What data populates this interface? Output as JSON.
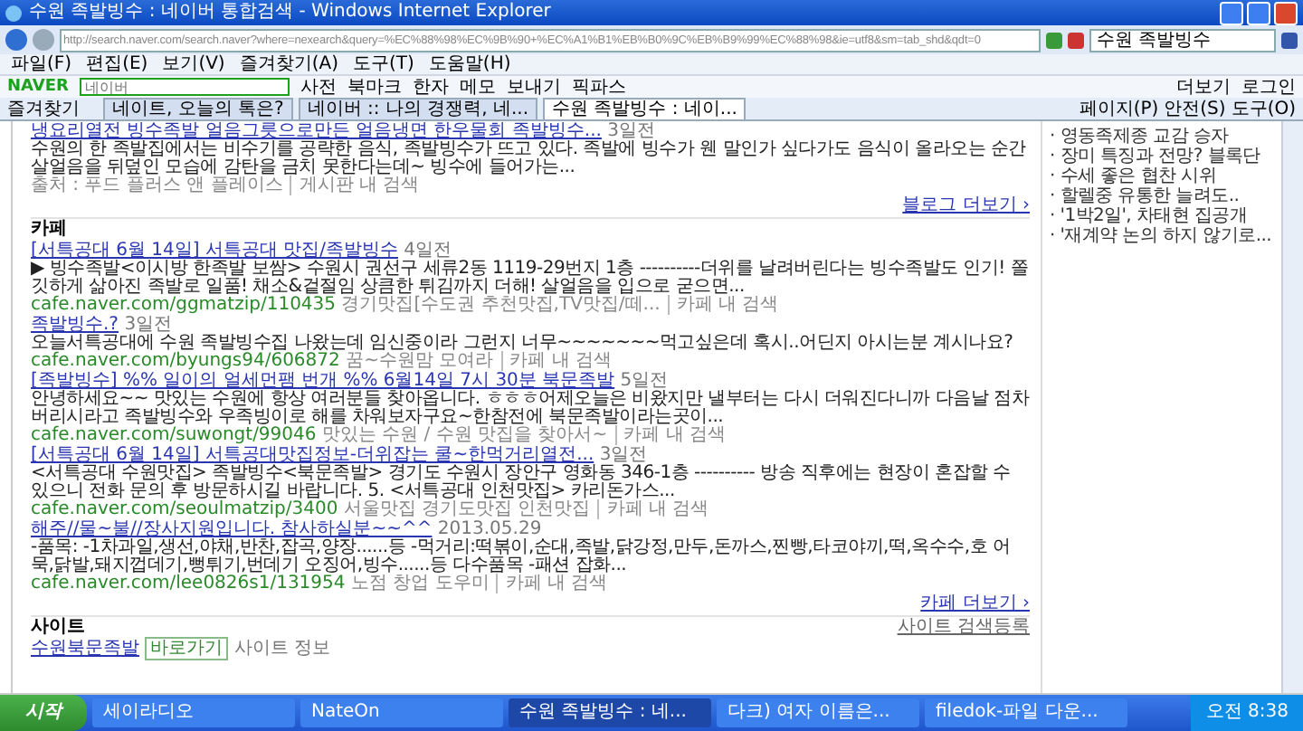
{
  "window": {
    "title": "수원 족발빙수 : 네이버 통합검색 - Windows Internet Explorer"
  },
  "address_bar": {
    "url": "http://search.naver.com/search.naver?where=nexearch&query=%EC%88%98%EC%9B%90+%EC%A1%B1%EB%B0%9C%EB%B9%99%EC%88%98&ie=utf8&sm=tab_shd&qdt=0"
  },
  "search_box": {
    "value": "수원 족발빙수"
  },
  "menu": [
    "파일(F)",
    "편집(E)",
    "보기(V)",
    "즐겨찾기(A)",
    "도구(T)",
    "도움말(H)"
  ],
  "toolbar": {
    "logo": "NAVER",
    "placeholder": "네이버",
    "buttons": [
      "사전",
      "북마크",
      "한자",
      "메모",
      "보내기",
      "픽파스"
    ],
    "right_buttons": [
      "더보기",
      "로그인"
    ]
  },
  "favorites": {
    "label": "즐겨찾기"
  },
  "tabs": [
    {
      "label": "네이트, 오늘의 톡은?",
      "selected": false
    },
    {
      "label": "네이버 :: 나의 경쟁력, 네...",
      "selected": false
    },
    {
      "label": "수원 족발빙수 : 네이...",
      "selected": true
    }
  ],
  "command_bar": [
    "페이지(P)",
    "안전(S)",
    "도구(O)"
  ],
  "blog": {
    "title": "냉요리열전 빙수족발 얼음그릇으로만든 얼음냉면 한우물회 족발빙수...",
    "age": "3일전",
    "description": "수원의 한 족발집에서는 비수기를 공략한 음식, 족발빙수가 뜨고 있다. 족발에 빙수가 웬 말인가 싶다가도 음식이 올라오는 순간 살얼음을 뒤덮인 모습에 감탄을 금치 못한다는데~ 빙수에 들어가는...",
    "source": "출처 : 푸드 플러스 앤 플레이스",
    "filter": "게시판 내 검색",
    "more": "블로그 더보기 ›"
  },
  "cafe": {
    "heading": "카페",
    "more": "카페 더보기 ›",
    "items": [
      {
        "title": "[서특공대 6월 14일] 서특공대 맛집/족발빙수",
        "age": "4일전",
        "description": "▶ 빙수족발<이시방 한족발 보쌈> 수원시 권선구 세류2동 1119-29번지 1층 ----------더위를 날려버린다는 빙수족발도 인기! 쫄깃하게 삶아진 족발로 일품! 채소&겉절임 상큼한 튀김까지 더해! 살얼음을 입으로 굳으면...",
        "url": "cafe.naver.com/ggmatzip/110435",
        "board": "경기맛집[수도권 추천맛집,TV맛집/떼...",
        "filter": "카페 내 검색"
      },
      {
        "title": "족발빙수.?",
        "age": "3일전",
        "description": "오늘서특공대에 수원 족발빙수집 나왔는데 임신중이라 그런지 너무~~~~~~~먹고싶은데 혹시..어딘지 아시는분 계시나요?",
        "url": "cafe.naver.com/byungs94/606872",
        "board": "꿈~수원맘 모여라",
        "filter": "카페 내 검색"
      },
      {
        "title": "[족발빙수] %% 일이의 얼세먼팸 번개 %% 6월14일 7시 30분 북문족발",
        "age": "5일전",
        "description": "안녕하세요~~ 맛있는 수원에 항상 여러분들 찾아옵니다. ㅎㅎㅎ어제오늘은 비왔지만 낼부터는 다시 더워진다니까 다음날 점차 버리시라고 족발빙수와 우족빙이로 해를 차워보자구요~한참전에 북문족발이라는곳이...",
        "url": "cafe.naver.com/suwongt/99046",
        "board": "맛있는 수원 / 수원 맛집을 찾아서~",
        "filter": "카페 내 검색"
      },
      {
        "title": "[서특공대 6월 14일] 서특공대맛집정보-더위잡는 쿨~한먹거리열전...",
        "age": "3일전",
        "description": "<서특공대 수원맛집> 족발빙수<북문족발> 경기도 수원시 장안구 영화동 346-1층 ---------- 방송 직후에는 현장이 혼잡할 수 있으니 전화 문의 후 방문하시길 바랍니다. 5. <서특공대 인천맛집> 카리돈가스...",
        "url": "cafe.naver.com/seoulmatzip/3400",
        "board": "서울맛집 경기도맛집 인천맛집",
        "filter": "카페 내 검색"
      },
      {
        "title": "해주//물~불//장사지원입니다. 참사하실분~~^^",
        "age": "2013.05.29",
        "description": "-품목: -1차과일,생선,야채,반찬,잡곡,양장......등 -먹거리:떡볶이,순대,족발,닭강정,만두,돈까스,찐빵,타코야끼,떡,옥수수,호 어묵,닭발,돼지껍데기,뻥튀기,번데기 오징어,빙수......등 다수품목 -패션 잡화...",
        "url": "cafe.naver.com/lee0826s1/131954",
        "board": "노점 창업 도우미",
        "filter": "카페 내 검색"
      }
    ]
  },
  "site": {
    "heading": "사이트",
    "register": "사이트 검색등록",
    "item": {
      "title": "수원북문족발",
      "tag": "바로가기",
      "note": "사이트 정보"
    }
  },
  "news": [
    "· 영동족제종 교감 승자",
    "· 장미 특징과 전망? 블록단",
    "· 수세 좋은 협찬 시위",
    "· 할렐중 유통한 늘려도..",
    "· '1박2일', 차태현 집공개",
    "· '재계약 논의 하지 않기로..."
  ],
  "taskbar": {
    "start": "시작",
    "clock": "오전 8:38",
    "items": [
      {
        "label": "세이라디오",
        "selected": false
      },
      {
        "label": "NateOn",
        "selected": false
      },
      {
        "label": "수원 족발빙수 : 네...",
        "selected": true
      },
      {
        "label": "다크) 여자 이름은...",
        "selected": false
      },
      {
        "label": "filedok-파일 다운...",
        "selected": false
      }
    ]
  }
}
